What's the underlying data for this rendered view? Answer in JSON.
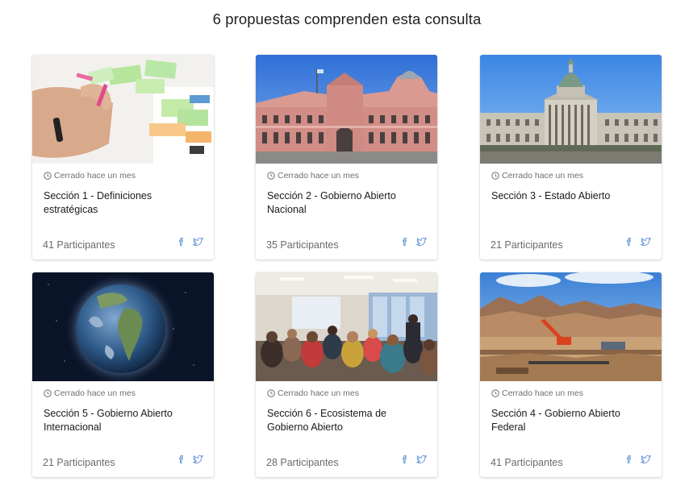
{
  "heading": "6 propuestas comprenden esta consulta",
  "cards": [
    {
      "status": "Cerrado hace un mes",
      "title": "Sección 1 - Definiciones estratégicas",
      "participants": "41 Participantes"
    },
    {
      "status": "Cerrado hace un mes",
      "title": "Sección 2 - Gobierno Abierto Nacional",
      "participants": "35 Participantes"
    },
    {
      "status": "Cerrado hace un mes",
      "title": "Sección 3 - Estado Abierto",
      "participants": "21 Participantes"
    },
    {
      "status": "Cerrado hace un mes",
      "title": "Sección 5 - Gobierno Abierto Internacional",
      "participants": "21 Participantes"
    },
    {
      "status": "Cerrado hace un mes",
      "title": "Sección 6 - Ecosistema de Gobierno Abierto",
      "participants": "28 Participantes"
    },
    {
      "status": "Cerrado hace un mes",
      "title": "Sección 4 - Gobierno Abierto Federal",
      "participants": "41 Participantes"
    }
  ],
  "icons": {
    "status": "clock-icon",
    "share_facebook": "facebook-icon",
    "share_twitter": "twitter-icon"
  },
  "colors": {
    "share_icon": "#5b8fd6",
    "muted_text": "#6b6b6b"
  }
}
